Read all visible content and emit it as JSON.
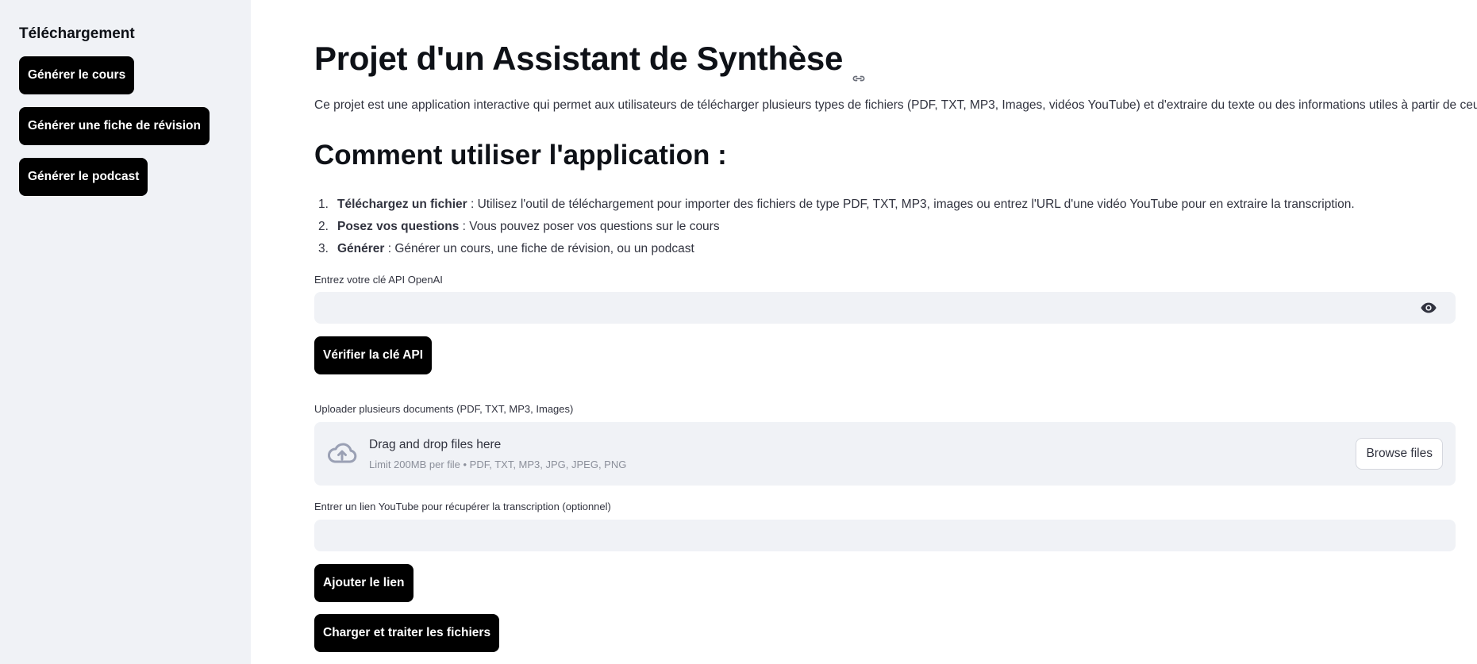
{
  "sidebar": {
    "title": "Téléchargement",
    "buttons": [
      "Générer le cours",
      "Générer une fiche de révision",
      "Générer le podcast"
    ]
  },
  "main": {
    "title": "Projet d'un Assistant de Synthèse",
    "intro": "Ce projet est une application interactive qui permet aux utilisateurs de télécharger plusieurs types de fichiers (PDF, TXT, MP3, Images, vidéos YouTube) et d'extraire du texte ou des informations utiles à partir de ceux-ci.",
    "subtitle": "Comment utiliser l'application :",
    "steps": [
      {
        "num": "1.",
        "bold": "Téléchargez un fichier",
        "text": " : Utilisez l'outil de téléchargement pour importer des fichiers de type PDF, TXT, MP3, images ou entrez l'URL d'une vidéo YouTube pour en extraire la transcription."
      },
      {
        "num": "2.",
        "bold": "Posez vos questions",
        "text": " : Vous pouvez poser vos questions sur le cours"
      },
      {
        "num": "3.",
        "bold": "Générer",
        "text": " : Générer un cours, une fiche de révision, ou un podcast"
      }
    ],
    "api_key": {
      "label": "Entrez votre clé API OpenAI",
      "value": "",
      "verify_button": "Vérifier la clé API"
    },
    "uploader": {
      "label": "Uploader plusieurs documents (PDF, TXT, MP3, Images)",
      "drop_title": "Drag and drop files here",
      "limit": "Limit 200MB per file • PDF, TXT, MP3, JPG, JPEG, PNG",
      "browse_button": "Browse files"
    },
    "youtube": {
      "label": "Entrer un lien YouTube pour récupérer la transcription (optionnel)",
      "value": "",
      "add_button": "Ajouter le lien"
    },
    "process_button": "Charger et traiter les fichiers"
  },
  "icons": {
    "link": "link-icon",
    "eye": "eye-icon",
    "cloud_upload": "cloud-upload-icon"
  },
  "colors": {
    "sidebar_bg": "#f0f2f6",
    "button_bg": "#000000",
    "input_bg": "#f0f2f6",
    "text": "#31333f"
  }
}
